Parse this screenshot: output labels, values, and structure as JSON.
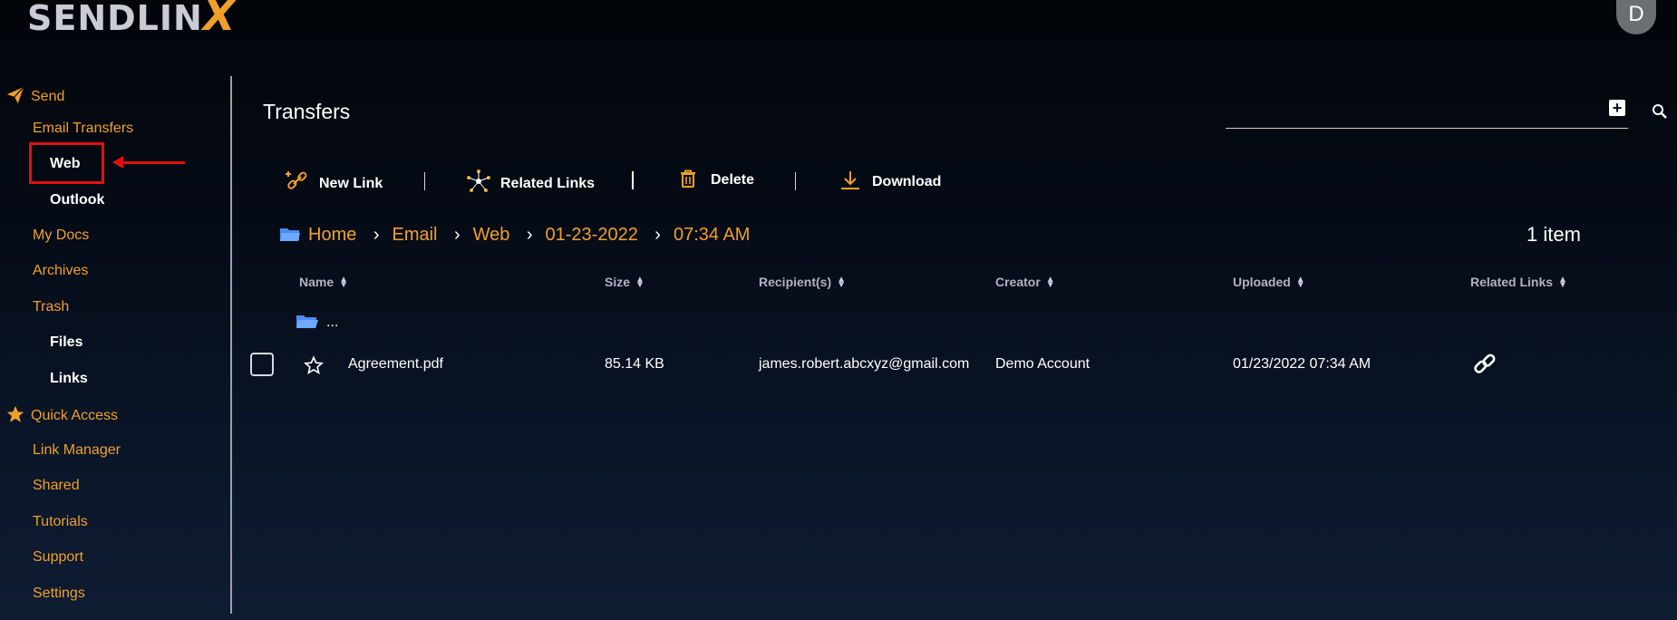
{
  "app": {
    "logo_text": "SENDLIN",
    "logo_x": "X",
    "avatar": "D"
  },
  "sidebar": {
    "send": "Send",
    "email_transfers": "Email Transfers",
    "web": "Web",
    "outlook": "Outlook",
    "my_docs": "My Docs",
    "archives": "Archives",
    "trash": "Trash",
    "files": "Files",
    "links": "Links",
    "quick_access": "Quick Access",
    "link_manager": "Link Manager",
    "shared": "Shared",
    "tutorials": "Tutorials",
    "support": "Support",
    "settings": "Settings"
  },
  "main": {
    "title": "Transfers",
    "toolbar": {
      "new_link": "New Link",
      "related_links": "Related Links",
      "delete": "Delete",
      "download": "Download"
    },
    "breadcrumb": [
      "Home",
      "Email",
      "Web",
      "01-23-2022",
      "07:34 AM"
    ],
    "item_count": "1 item",
    "columns": [
      "Name",
      "Size",
      "Recipient(s)",
      "Creator",
      "Uploaded",
      "Related Links"
    ],
    "parent_folder": "...",
    "rows": [
      {
        "name": "Agreement.pdf",
        "size": "85.14 KB",
        "recipients": "james.robert.abcxyz@gmail.com",
        "creator": "Demo Account",
        "uploaded": "01/23/2022 07:34 AM"
      }
    ]
  },
  "colors": {
    "accent": "#f0a02a",
    "annotation": "#e01010",
    "background": "#050b16"
  }
}
